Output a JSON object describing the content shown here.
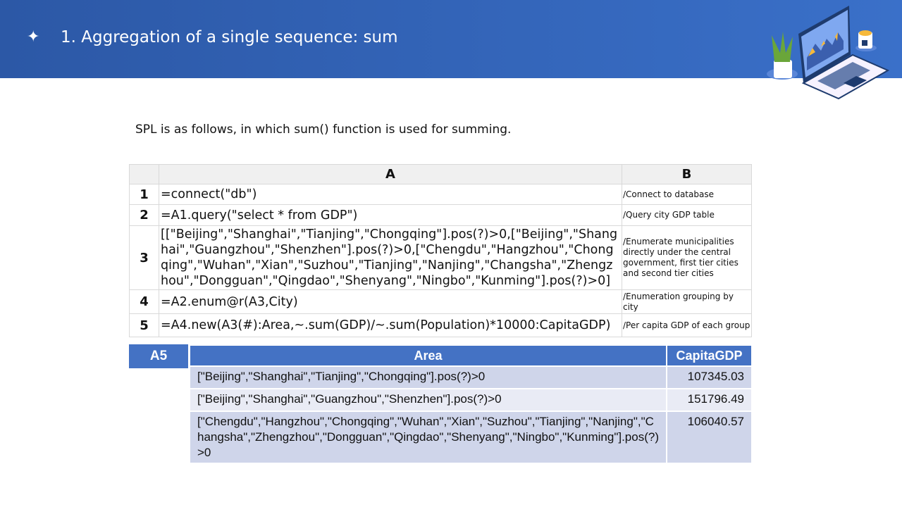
{
  "header": {
    "bullet": "✦",
    "title": "1. Aggregation of a single sequence: sum"
  },
  "intro": "SPL is as follows, in which sum() function is used for summing.",
  "code": {
    "col_a": "A",
    "col_b": "B",
    "rows": [
      {
        "num": "1",
        "a": "=connect(\"db\")",
        "b": "/Connect to database"
      },
      {
        "num": "2",
        "a": "=A1.query(\"select * from GDP\")",
        "b": "/Query city GDP table"
      },
      {
        "num": "3",
        "a": "[[\"Beijing\",\"Shanghai\",\"Tianjing\",\"Chongqing\"].pos(?)>0,[\"Beijing\",\"Shanghai\",\"Guangzhou\",\"Shenzhen\"].pos(?)>0,[\"Chengdu\",\"Hangzhou\",\"Chongqing\",\"Wuhan\",\"Xian\",\"Suzhou\",\"Tianjing\",\"Nanjing\",\"Changsha\",\"Zhengzhou\",\"Dongguan\",\"Qingdao\",\"Shenyang\",\"Ningbo\",\"Kunming\"].pos(?)>0]",
        "b": "/Enumerate municipalities directly under the central government, first tier cities and second tier cities"
      },
      {
        "num": "4",
        "a": "=A2.enum@r(A3,City)",
        "b": "/Enumeration grouping by city"
      },
      {
        "num": "5",
        "a": "=A4.new(A3(#):Area,~.sum(GDP)/~.sum(Population)*10000:CapitaGDP)",
        "b": "/Per capita GDP of each group"
      }
    ]
  },
  "result": {
    "label": "A5",
    "columns": [
      "Area",
      "CapitaGDP"
    ],
    "rows": [
      {
        "area": "[\"Beijing\",\"Shanghai\",\"Tianjing\",\"Chongqing\"].pos(?)>0",
        "gdp": "107345.03"
      },
      {
        "area": "[\"Beijing\",\"Shanghai\",\"Guangzhou\",\"Shenzhen\"].pos(?)>0",
        "gdp": "151796.49"
      },
      {
        "area": "[\"Chengdu\",\"Hangzhou\",\"Chongqing\",\"Wuhan\",\"Xian\",\"Suzhou\",\"Tianjing\",\"Nanjing\",\"Changsha\",\"Zhengzhou\",\"Dongguan\",\"Qingdao\",\"Shenyang\",\"Ningbo\",\"Kunming\"].pos(?)>0",
        "gdp": "106040.57"
      }
    ]
  },
  "colors": {
    "banner": "#2c58a6",
    "table_header": "#4472c4",
    "row_odd": "#cfd5ea",
    "row_even": "#e9ebf5"
  }
}
